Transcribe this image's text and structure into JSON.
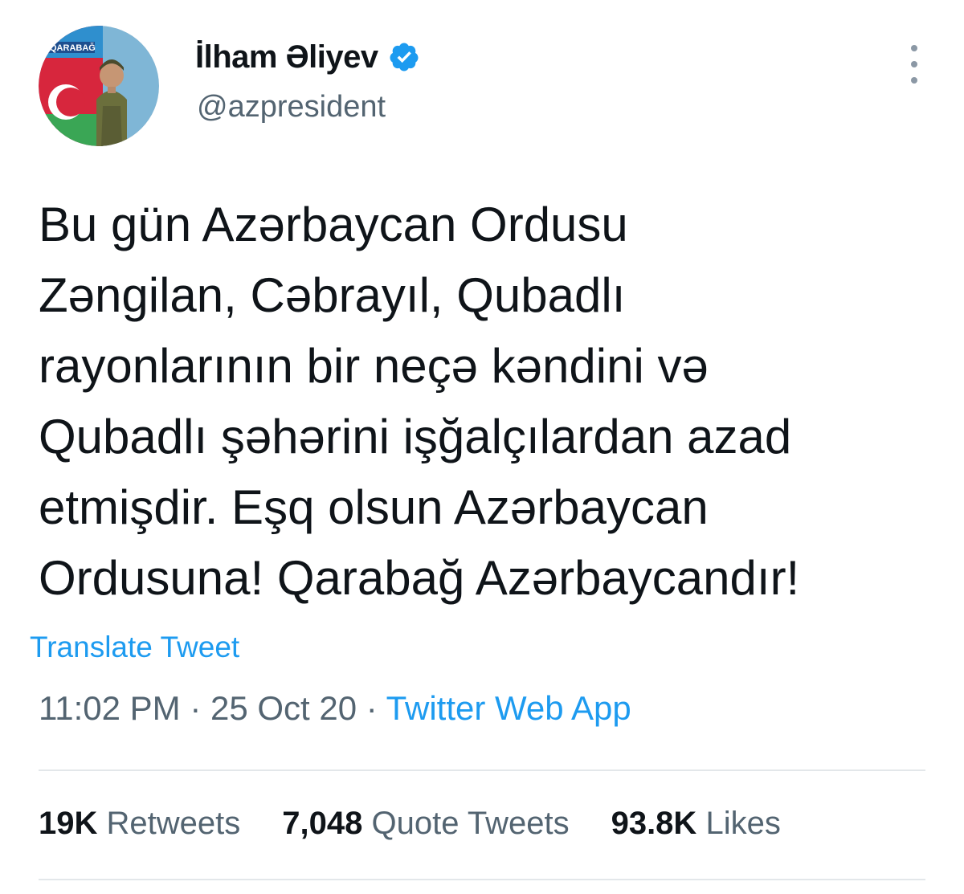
{
  "author": {
    "display_name": "İlham Əliyev",
    "handle": "@azpresident",
    "verified": true,
    "avatar_banner_text": "QARABAĞ"
  },
  "tweet": {
    "lines": [
      "Bu gün Azərbaycan Ordusu",
      "Zəngilan, Cəbrayıl, Qubadlı",
      "rayonlarının bir neçə kəndini və",
      "Qubadlı şəhərini işğalçılardan azad",
      "etmişdir. Eşq olsun Azərbaycan",
      "Ordusuna! Qarabağ Azərbaycandır!"
    ],
    "translate_label": "Translate Tweet"
  },
  "meta": {
    "time": "11:02 PM",
    "separator": " · ",
    "date": "25 Oct 20",
    "source": "Twitter Web App"
  },
  "stats": {
    "retweets_count": "19K",
    "retweets_label": "Retweets",
    "quotes_count": "7,048",
    "quotes_label": "Quote Tweets",
    "likes_count": "93.8K",
    "likes_label": "Likes"
  },
  "colors": {
    "text": "#0f1419",
    "secondary_text": "#536471",
    "link": "#1d9bf0",
    "verified_badge": "#1d9bf0",
    "divider": "#e3e7ea"
  },
  "icons": {
    "verified": "verified-badge-icon",
    "more": "more-options-icon"
  }
}
